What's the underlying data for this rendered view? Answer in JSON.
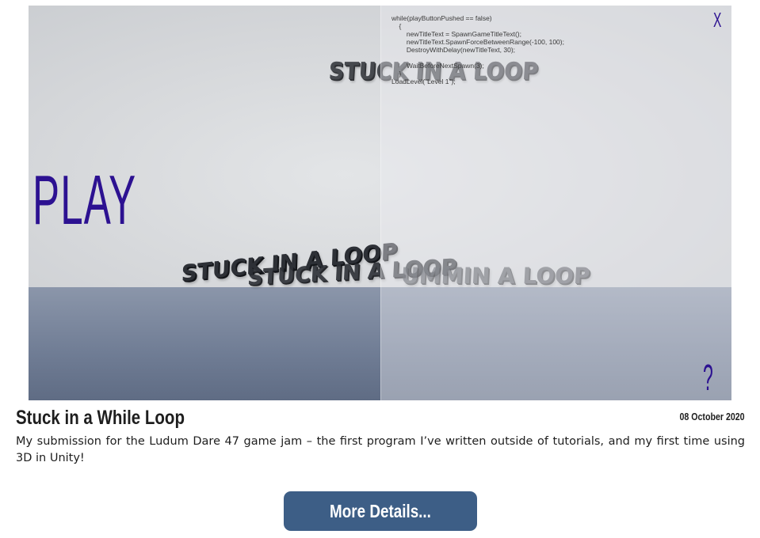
{
  "game_screenshot": {
    "code_lines": "while(playButtonPushed == false)\n    {\n        newTitleText = SpawnGameTitleText();\n        newTitleText.SpawnForceBetweenRange(-100, 100);\n        DestroyWithDelay(newTitleText, 30);\n\n        WaitBeforeNextSpawn(3);\n    }\nLoadLevel(\"Level 1\");",
    "play_label": "PLAY",
    "close_label": "X",
    "help_label": "?",
    "floating_titles": {
      "top": "STUCK IN A LOOP",
      "left": "STUCK IN A LOOP",
      "middle": "STUCK IN A LOOP",
      "right": "UMMIN A LOOP"
    },
    "colors": {
      "ui_text": "#2c1191",
      "floor": "#6f7c94",
      "sky": "#d7d9dc"
    }
  },
  "post": {
    "title": "Stuck in a While Loop",
    "date": "08 October 2020",
    "description": "My submission for the Ludum Dare 47 game jam – the first program I’ve written outside of tutorials, and my first time using 3D in Unity!",
    "button_label": "More Details...",
    "button_color": "#3d5e86"
  }
}
